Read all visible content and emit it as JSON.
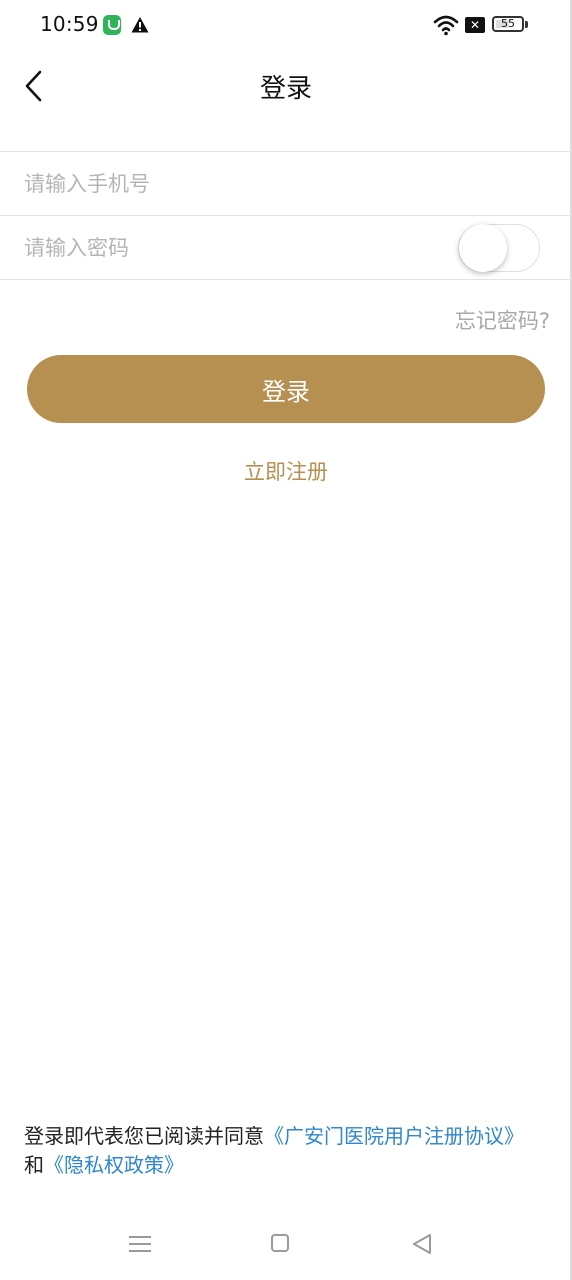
{
  "status_bar": {
    "time": "10:59",
    "battery": "55",
    "battery_level": 0.55,
    "icons": [
      "app-notification-icon",
      "warning-icon",
      "wifi-icon",
      "sim-off-icon",
      "battery-icon"
    ]
  },
  "nav": {
    "title": "登录",
    "back_icon": "chevron-left-icon"
  },
  "form": {
    "phone_placeholder": "请输入手机号",
    "phone_value": "",
    "password_placeholder": "请输入密码",
    "password_value": "",
    "show_password_toggle": false,
    "forgot_label": "忘记密码?",
    "login_label": "登录",
    "register_label": "立即注册"
  },
  "agreement": {
    "prefix": "登录即代表您已阅读并同意",
    "user_agreement": "《广安门医院用户注册协议》",
    "conjunction": "和",
    "privacy_policy": "《隐私权政策》"
  },
  "system_nav": {
    "icons": [
      "menu-icon",
      "home-icon",
      "back-triangle-icon"
    ]
  },
  "colors": {
    "accent": "#b59051",
    "link": "#2f86d1",
    "placeholder": "#b5b5b5",
    "divider": "#e3e3e3"
  }
}
